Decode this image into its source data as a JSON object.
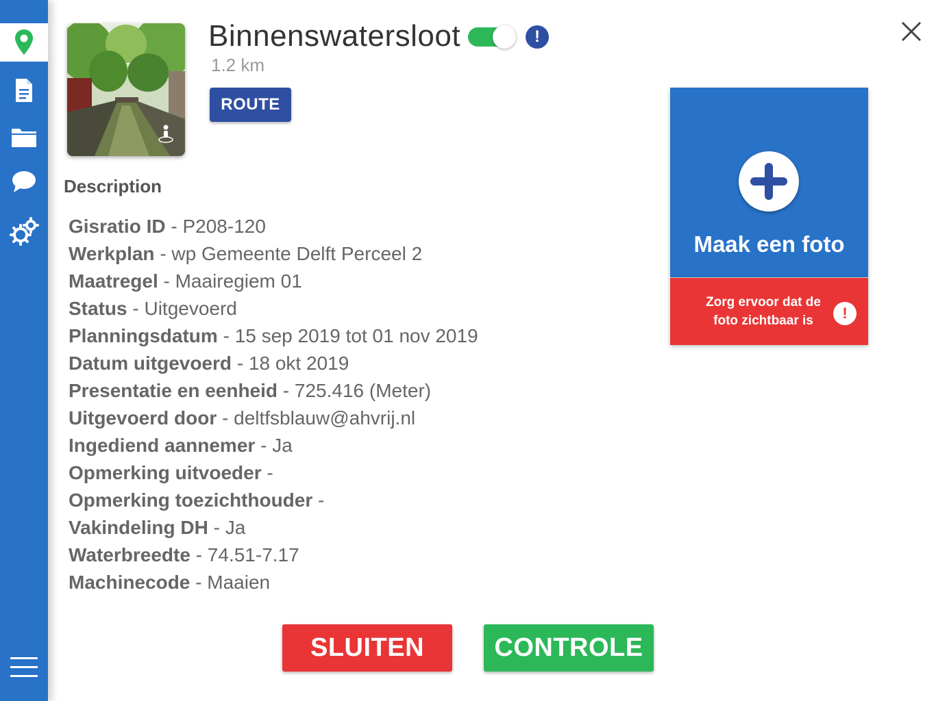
{
  "sidebar": {
    "items": [
      {
        "name": "map-pin-icon",
        "active": true
      },
      {
        "name": "document-icon",
        "active": false
      },
      {
        "name": "folder-icon",
        "active": false
      },
      {
        "name": "chat-bubble-icon",
        "active": false
      },
      {
        "name": "settings-gear-icon",
        "active": false
      }
    ],
    "menu_icon": "hamburger-menu-icon",
    "color": "#2872c8"
  },
  "header": {
    "title": "Binnenswatersloot",
    "distance": "1.2 km",
    "toggle_on": true,
    "info_icon_text": "!",
    "route_label": "ROUTE",
    "close_icon": "close-icon"
  },
  "description": {
    "heading": "Description",
    "rows": [
      {
        "key": "Gisratio ID",
        "value": "P208-120"
      },
      {
        "key": "Werkplan",
        "value": "wp Gemeente Delft Perceel 2"
      },
      {
        "key": "Maatregel",
        "value": "Maairegiem 01"
      },
      {
        "key": "Status",
        "value": "Uitgevoerd"
      },
      {
        "key": "Planningsdatum",
        "value": "15 sep 2019 tot 01 nov 2019"
      },
      {
        "key": "Datum uitgevoerd",
        "value": "18 okt 2019"
      },
      {
        "key": "Presentatie en eenheid",
        "value": "725.416 (Meter)"
      },
      {
        "key": "Uitgevoerd door",
        "value": "deltfsblauw@ahvrij.nl"
      },
      {
        "key": "Ingediend aannemer",
        "value": "Ja"
      },
      {
        "key": "Opmerking uitvoeder",
        "value": ""
      },
      {
        "key": "Opmerking toezichthouder",
        "value": ""
      },
      {
        "key": "Vakindeling DH",
        "value": "Ja"
      },
      {
        "key": "Waterbreedte",
        "value": "74.51-7.17"
      },
      {
        "key": "Machinecode",
        "value": "Maaien"
      }
    ],
    "separator": "-"
  },
  "photo": {
    "label": "Maak een foto",
    "warning": "Zorg ervoor dat de foto zichtbaar is",
    "warning_icon_text": "!"
  },
  "actions": {
    "close_label": "SLUITEN",
    "check_label": "CONTROLE"
  },
  "colors": {
    "primary_blue": "#2872c8",
    "dark_blue": "#2f4fa3",
    "red": "#e93535",
    "green": "#2cb859"
  }
}
